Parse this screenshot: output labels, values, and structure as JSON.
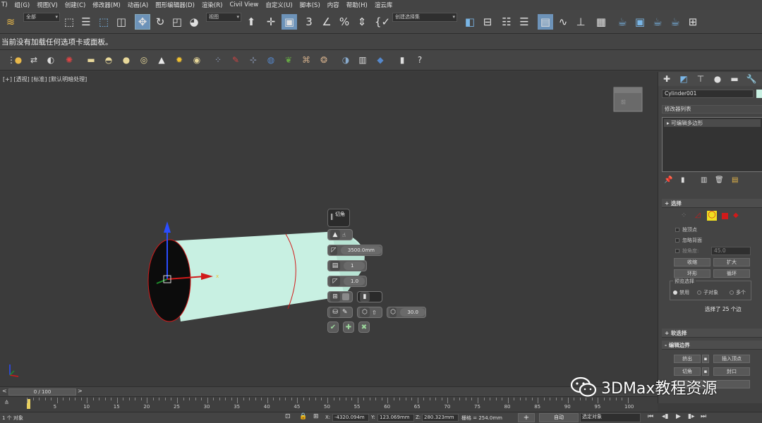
{
  "menu": [
    "T)",
    "组(G)",
    "视图(V)",
    "创建(C)",
    "修改器(M)",
    "动画(A)",
    "图形编辑器(D)",
    "渲染(R)",
    "Civil View",
    "自定义(U)",
    "脚本(S)",
    "内容",
    "帮助(H)",
    "渲云库"
  ],
  "toolbar": {
    "filter_value": "全部",
    "refcoord_value": "视图",
    "selset_value": "创建选择集"
  },
  "info_message": "当前没有加载任何选项卡或面板。",
  "viewport": {
    "label": "[+] [透视] [标准] [默认明暗处理]",
    "axis_x": "x",
    "caddy": {
      "title": "切角",
      "amount": "3500.0mm",
      "segments": "1",
      "tension": "1.0",
      "smooth": "30.0"
    },
    "colors": {
      "cylinder": "#c8f0e2",
      "end_cap": "#0c0c0c",
      "edge_select": "#d11a1a"
    }
  },
  "command_panel": {
    "object_name": "Cylinder001",
    "modifier_list": "修改器列表",
    "stack_item": "可编辑多边形",
    "selection": {
      "title": "选择",
      "by_vertex": "按顶点",
      "ignore_back": "忽略背面",
      "by_angle": "按角度:",
      "angle": "45.0",
      "shrink": "收缩",
      "grow": "扩大",
      "ring": "环形",
      "loop": "循环",
      "preview": "预览选择",
      "disabled": "禁用",
      "subobject": "子对象",
      "multi": "多个",
      "status": "选择了 25 个边"
    },
    "soft_select": "软选择",
    "edit_edges": {
      "title": "编辑边界",
      "extrude": "挤出",
      "insert_vertex": "插入顶点",
      "chamfer": "切角",
      "cap": "封口"
    }
  },
  "timeline": {
    "slider": "0 / 100",
    "ticks": [
      "5",
      "10",
      "15",
      "20",
      "25",
      "30",
      "35",
      "40",
      "45",
      "50",
      "55",
      "60",
      "65",
      "70",
      "75",
      "80",
      "85",
      "90",
      "95",
      "100"
    ]
  },
  "status": {
    "selected": "1 个 对象",
    "x_label": "X:",
    "x": "-4320.094m",
    "y_label": "Y:",
    "y": "123.069mm",
    "z_label": "Z:",
    "z": "280.323mm",
    "grid": "栅格 = 254.0mm",
    "auto": "自动",
    "selected_obj": "选定对象"
  },
  "watermark": "3DMax教程资源"
}
